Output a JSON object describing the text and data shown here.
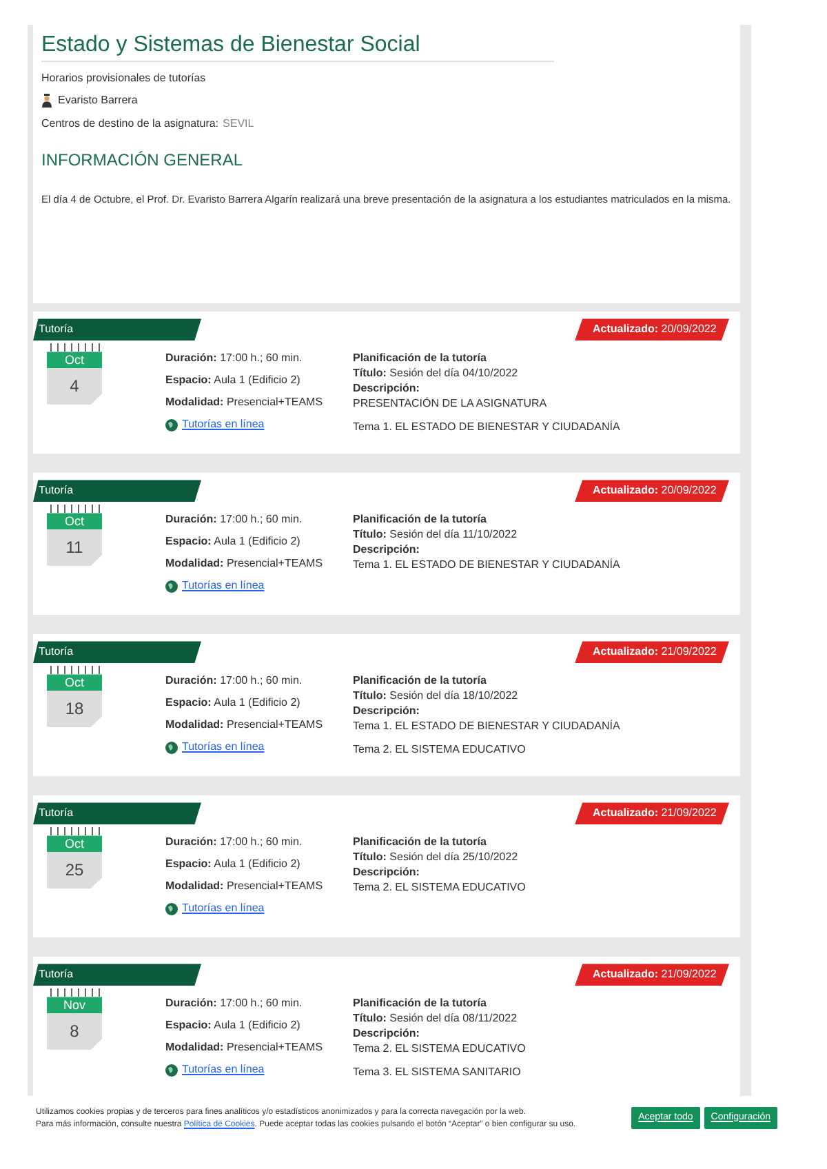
{
  "header": {
    "title": "Estado y Sistemas de Bienestar Social",
    "subtitle": "Horarios provisionales de tutorías",
    "teacher": "Evaristo Barrera",
    "centers_label": "Centros de destino de la asignatura:",
    "centers_value": "SEVIL"
  },
  "section_title": "INFORMACIÓN GENERAL",
  "notice": "El día 4 de Octubre, el Prof. Dr. Evaristo Barrera Algarín realizará una breve presentación de la asignatura a los estudiantes matriculados en la misma.",
  "sessions": [
    {
      "tag": "Tutoría",
      "updated_label": "Actualizado:",
      "updated_date": "20/09/2022",
      "month": "Oct",
      "day": "4",
      "fields": [
        {
          "label": "Duración:",
          "value": "17:00 h.; 60 min."
        },
        {
          "label": "Espacio:",
          "value": "Aula 1 (Edificio 2)"
        },
        {
          "label": "Modalidad:",
          "value": "Presencial+TEAMS"
        }
      ],
      "link": "Tutorías en línea",
      "plan_title": "Planificación de la tutoría",
      "title_label": "Título:",
      "title_value": "Sesión del día 04/10/2022",
      "desc_label": "Descripción:",
      "desc_lines": [
        "PRESENTACIÓN DE LA ASIGNATURA",
        "Tema 1. EL ESTADO DE BIENESTAR Y CIUDADANÍA"
      ]
    },
    {
      "tag": "Tutoría",
      "updated_label": "Actualizado:",
      "updated_date": "20/09/2022",
      "month": "Oct",
      "day": "11",
      "fields": [
        {
          "label": "Duración:",
          "value": "17:00 h.; 60 min."
        },
        {
          "label": "Espacio:",
          "value": "Aula 1 (Edificio 2)"
        },
        {
          "label": "Modalidad:",
          "value": "Presencial+TEAMS"
        }
      ],
      "link": "Tutorías en línea",
      "plan_title": "Planificación de la tutoría",
      "title_label": "Título:",
      "title_value": "Sesión del día 11/10/2022",
      "desc_label": "Descripción:",
      "desc_lines": [
        "Tema 1. EL ESTADO DE BIENESTAR Y CIUDADANÍA"
      ]
    },
    {
      "tag": "Tutoría",
      "updated_label": "Actualizado:",
      "updated_date": "21/09/2022",
      "month": "Oct",
      "day": "18",
      "fields": [
        {
          "label": "Duración:",
          "value": "17:00 h.; 60 min."
        },
        {
          "label": "Espacio:",
          "value": "Aula 1 (Edificio 2)"
        },
        {
          "label": "Modalidad:",
          "value": "Presencial+TEAMS"
        }
      ],
      "link": "Tutorías en línea",
      "plan_title": "Planificación de la tutoría",
      "title_label": "Título:",
      "title_value": "Sesión del día 18/10/2022",
      "desc_label": "Descripción:",
      "desc_lines": [
        "Tema 1. EL ESTADO DE BIENESTAR Y CIUDADANÍA",
        "Tema 2. EL SISTEMA EDUCATIVO"
      ]
    },
    {
      "tag": "Tutoría",
      "updated_label": "Actualizado:",
      "updated_date": "21/09/2022",
      "month": "Oct",
      "day": "25",
      "fields": [
        {
          "label": "Duración:",
          "value": "17:00 h.; 60 min."
        },
        {
          "label": "Espacio:",
          "value": "Aula 1 (Edificio 2)"
        },
        {
          "label": "Modalidad:",
          "value": "Presencial+TEAMS"
        }
      ],
      "link": "Tutorías en línea",
      "plan_title": "Planificación de la tutoría",
      "title_label": "Título:",
      "title_value": "Sesión del día 25/10/2022",
      "desc_label": "Descripción:",
      "desc_lines": [
        "Tema 2. EL SISTEMA EDUCATIVO"
      ]
    },
    {
      "tag": "Tutoría",
      "updated_label": "Actualizado:",
      "updated_date": "21/09/2022",
      "month": "Nov",
      "day": "8",
      "fields": [
        {
          "label": "Duración:",
          "value": "17:00 h.; 60 min."
        },
        {
          "label": "Espacio:",
          "value": "Aula 1 (Edificio 2)"
        },
        {
          "label": "Modalidad:",
          "value": "Presencial+TEAMS"
        }
      ],
      "link": "Tutorías en línea",
      "plan_title": "Planificación de la tutoría",
      "title_label": "Título:",
      "title_value": "Sesión del día 08/11/2022",
      "desc_label": "Descripción:",
      "desc_lines": [
        "Tema 2. EL SISTEMA EDUCATIVO",
        "Tema 3. EL SISTEMA SANITARIO"
      ]
    }
  ],
  "cookie_banner": {
    "line1": "Utilizamos cookies propias y de terceros para fines analíticos y/o estadísticos anonimizados y para la correcta navegación por la web.",
    "line2_before": "Para más información, consulte nuestra ",
    "link": "Política de Cookies",
    "line2_after": ". Puede aceptar todas las cookies pulsando el botón “Aceptar” o bien configurar su uso.",
    "buttons": [
      "Aceptar todo",
      "Configuración"
    ]
  }
}
